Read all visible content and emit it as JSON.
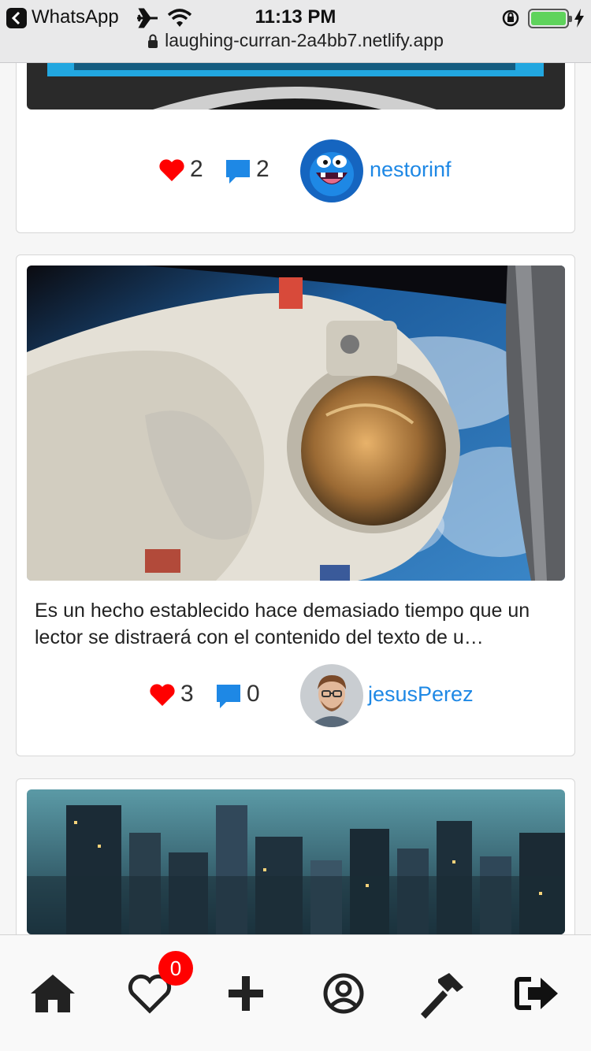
{
  "status_bar": {
    "back_app": "WhatsApp",
    "time": "11:13 PM",
    "url": "laughing-curran-2a4bb7.netlify.app"
  },
  "feed": {
    "posts": [
      {
        "likes": "2",
        "comments": "2",
        "username": "nestorinf",
        "description": ""
      },
      {
        "likes": "3",
        "comments": "0",
        "username": "jesusPerez",
        "description": "Es un hecho establecido hace demasiado tiempo que un lector se distraerá con el contenido del texto de u…"
      }
    ]
  },
  "bottom_nav": {
    "likes_badge": "0"
  },
  "colors": {
    "like": "#ff0000",
    "comment": "#1e88e5",
    "username": "#1e88e5",
    "badge": "#ff0000"
  }
}
